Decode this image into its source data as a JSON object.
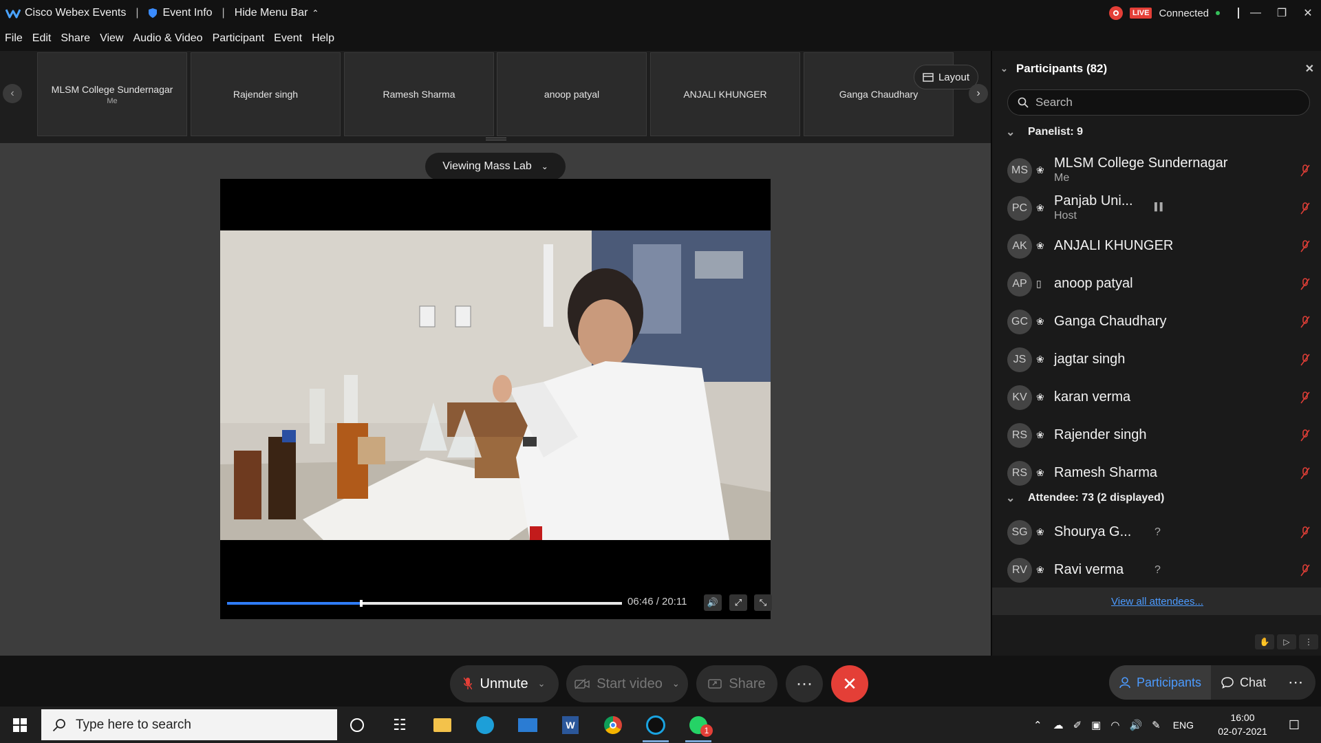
{
  "titlebar": {
    "app_name": "Cisco Webex Events",
    "event_info": "Event Info",
    "hide_menu": "Hide Menu Bar",
    "live_badge": "LIVE",
    "status": "Connected"
  },
  "menu": {
    "items": [
      "File",
      "Edit",
      "Share",
      "View",
      "Audio & Video",
      "Participant",
      "Event",
      "Help"
    ]
  },
  "strip": {
    "layout_label": "Layout",
    "thumbnails": [
      {
        "name": "MLSM College Sundernagar",
        "sub": "Me"
      },
      {
        "name": "Rajender singh",
        "sub": ""
      },
      {
        "name": "Ramesh Sharma",
        "sub": ""
      },
      {
        "name": "anoop patyal",
        "sub": ""
      },
      {
        "name": "ANJALI KHUNGER",
        "sub": ""
      },
      {
        "name": "Ganga Chaudhary",
        "sub": ""
      }
    ]
  },
  "stage": {
    "viewing_label": "Viewing Mass Lab",
    "time": "06:46 / 20:11",
    "progress_fraction": 0.337
  },
  "bottom": {
    "unmute": "Unmute",
    "start_video": "Start video",
    "share": "Share",
    "participants_tab": "Participants",
    "chat_tab": "Chat"
  },
  "panel": {
    "title": "Participants (82)",
    "search_placeholder": "Search",
    "panelist_header": "Panelist: 9",
    "attendee_header": "Attendee: 73 (2 displayed)",
    "view_all": "View all attendees...",
    "panelists": [
      {
        "initials": "MS",
        "name": "MLSM College Sundernagar",
        "sub": "Me"
      },
      {
        "initials": "PC",
        "name": "Panjab Uni...",
        "sub": "Host"
      },
      {
        "initials": "AK",
        "name": "ANJALI KHUNGER",
        "sub": ""
      },
      {
        "initials": "AP",
        "name": "anoop patyal",
        "sub": ""
      },
      {
        "initials": "GC",
        "name": "Ganga Chaudhary",
        "sub": ""
      },
      {
        "initials": "JS",
        "name": "jagtar singh",
        "sub": ""
      },
      {
        "initials": "KV",
        "name": "karan verma",
        "sub": ""
      },
      {
        "initials": "RS",
        "name": "Rajender singh",
        "sub": ""
      },
      {
        "initials": "RS",
        "name": "Ramesh Sharma",
        "sub": ""
      }
    ],
    "attendees": [
      {
        "initials": "SG",
        "name": "Shourya G...",
        "flag": "?"
      },
      {
        "initials": "RV",
        "name": "Ravi verma",
        "flag": "?"
      }
    ]
  },
  "taskbar": {
    "search_placeholder": "Type here to search",
    "lang": "ENG",
    "time": "16:00",
    "date": "02-07-2021",
    "badge": "1"
  },
  "colors": {
    "accent": "#4c9bff",
    "end_call": "#e43f37",
    "live": "#e43f37",
    "connected_dot": "#35c05a",
    "progress": "#2f7cf6"
  }
}
